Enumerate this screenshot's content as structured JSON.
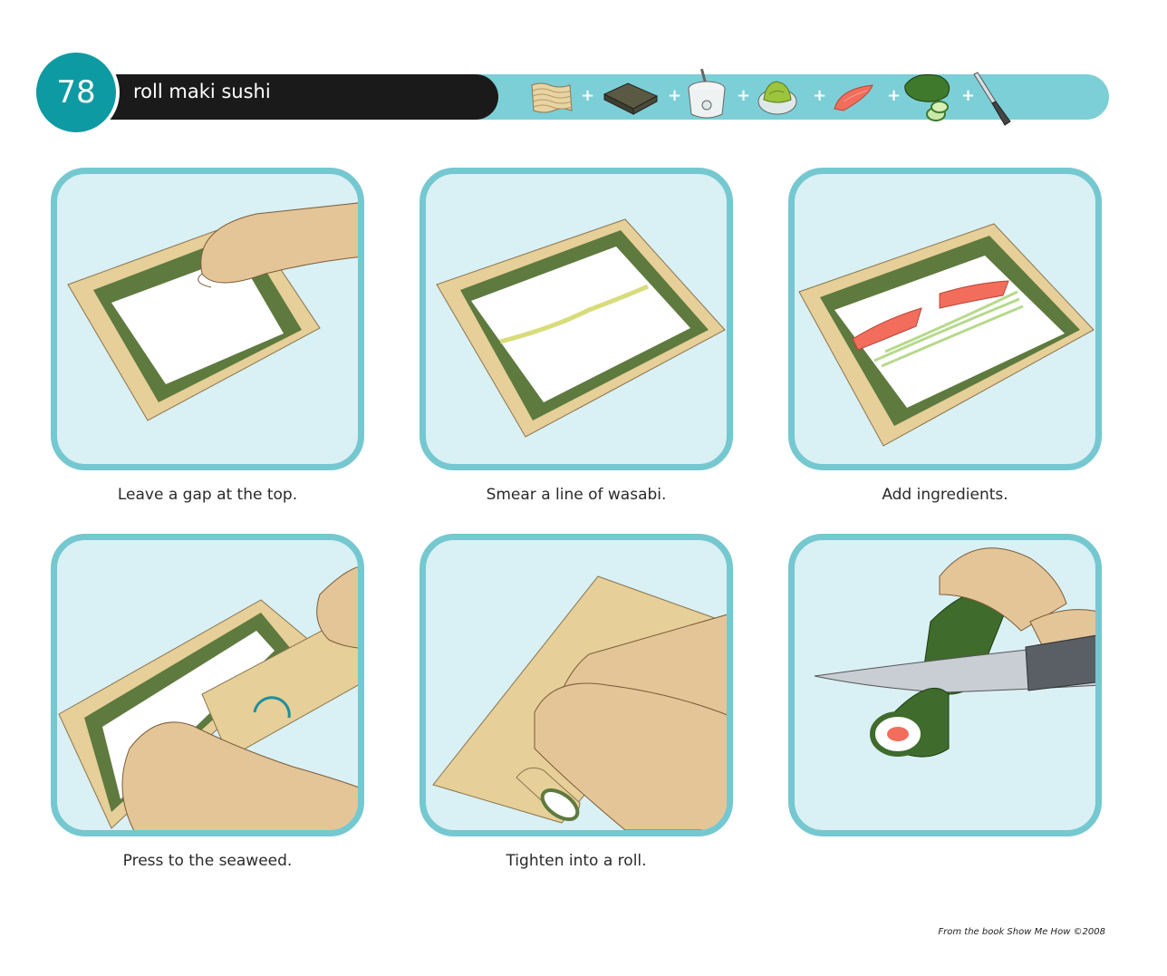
{
  "header": {
    "step_number": "78",
    "title": "roll maki sushi",
    "tools": [
      {
        "icon": "bamboo-mat-icon"
      },
      {
        "icon": "nori-sheet-icon"
      },
      {
        "icon": "rice-cooker-icon"
      },
      {
        "icon": "wasabi-icon"
      },
      {
        "icon": "salmon-icon"
      },
      {
        "icon": "cucumber-icon"
      },
      {
        "icon": "knife-icon"
      }
    ],
    "plus_symbol": "+"
  },
  "steps": [
    {
      "caption": "Leave a gap at the top."
    },
    {
      "caption": "Smear a line of wasabi."
    },
    {
      "caption": "Add ingredients."
    },
    {
      "caption": "Press to the seaweed."
    },
    {
      "caption": "Tighten into a roll."
    },
    {
      "caption": ""
    }
  ],
  "footer": {
    "credit": "From the book Show Me How ©2008"
  },
  "colors": {
    "teal_accent": "#75c8d0",
    "step_circle": "#0d9aa2",
    "title_bar": "#1a1a1a",
    "panel_bg": "#d9f0f4",
    "nori": "#5e7a3e",
    "bamboo": "#e6cf98",
    "salmon": "#f26d5b",
    "skin": "#e4c597"
  }
}
